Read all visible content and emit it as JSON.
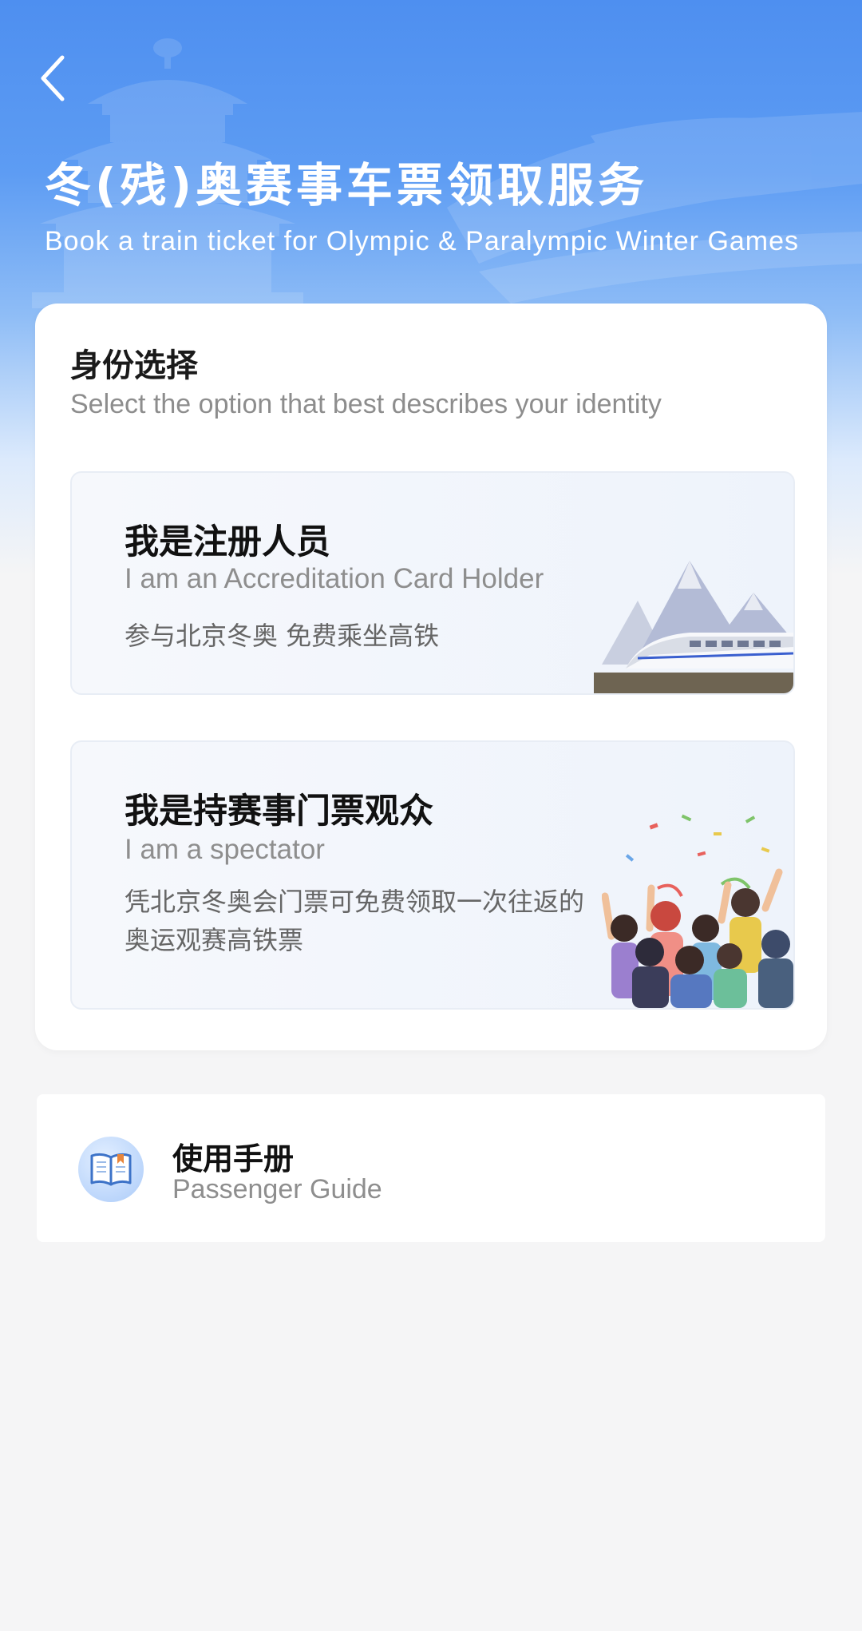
{
  "header": {
    "back_icon": "chevron-left-icon",
    "title": "冬(残)奥赛事车票领取服务",
    "subtitle": "Book a train ticket for Olympic & Paralympic Winter Games"
  },
  "identity": {
    "title": "身份选择",
    "subtitle": "Select the option that best describes your identity",
    "options": [
      {
        "title": "我是注册人员",
        "english": "I am an Accreditation Card Holder",
        "description": "参与北京冬奥 免费乘坐高铁",
        "illustration": "train-mountains-illustration"
      },
      {
        "title": "我是持赛事门票观众",
        "english": "I am a spectator",
        "description": "凭北京冬奥会门票可免费领取一次往返的奥运观赛高铁票",
        "illustration": "cheering-crowd-illustration"
      }
    ]
  },
  "guide": {
    "icon": "book-icon",
    "title": "使用手册",
    "subtitle": "Passenger Guide"
  },
  "colors": {
    "hero_blue": "#4e8ff0",
    "page_background": "#f5f5f6",
    "card_background": "#ffffff"
  }
}
